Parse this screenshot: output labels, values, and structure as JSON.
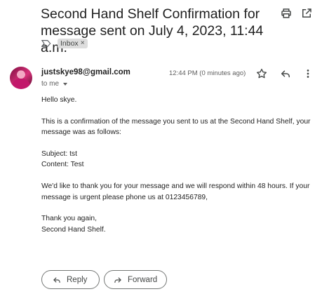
{
  "email": {
    "subject": "Second Hand Shelf Confirmation for message sent on July 4, 2023, 11:44 a.m.",
    "labels": [
      {
        "name": "Inbox",
        "remove_glyph": "×"
      }
    ],
    "sender": {
      "email": "justskye98@gmail.com",
      "recipient": "to me",
      "timestamp": "12:44 PM (0 minutes ago)"
    },
    "body": {
      "greeting": "Hello skye.",
      "intro": "This is a confirmation of the message you sent to us at the Second Hand Shelf, your message was as follows:",
      "subject_line": "Subject: tst",
      "content_line": "Content: Test",
      "thanks": "We'd like to thank you for your message and we will respond within 48 hours. If your message is urgent please phone us at 0123456789,",
      "closing": "Thank you again,",
      "signature": "Second Hand Shelf."
    },
    "actions": {
      "reply_label": "Reply",
      "forward_label": "Forward"
    }
  },
  "icons": {
    "print": "print-icon",
    "open_new_window": "open-in-new-window-icon",
    "label_arrow": "label-important-icon",
    "star": "star-icon",
    "reply": "reply-icon",
    "more": "more-vertical-icon",
    "forward": "forward-icon"
  }
}
